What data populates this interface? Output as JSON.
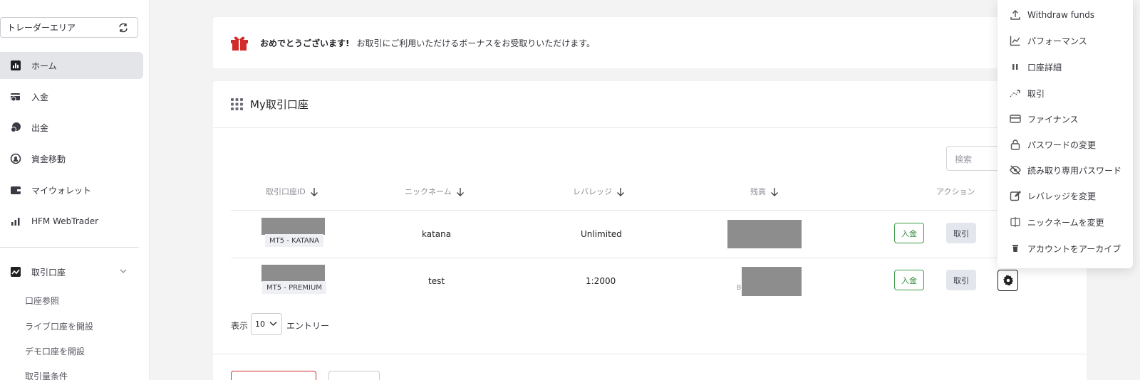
{
  "sidebar": {
    "area_select": "トレーダーエリア",
    "items": [
      {
        "label": "ホーム",
        "icon": "chart-bar-icon"
      },
      {
        "label": "入金",
        "icon": "deposit-icon"
      },
      {
        "label": "出金",
        "icon": "withdraw-icon"
      },
      {
        "label": "資金移動",
        "icon": "transfer-icon"
      },
      {
        "label": "マイウォレット",
        "icon": "wallet-icon"
      },
      {
        "label": "HFM WebTrader",
        "icon": "bar-chart-icon"
      }
    ],
    "section": {
      "label": "取引口座",
      "icon": "trading-icon"
    },
    "sub_items": [
      "口座参照",
      "ライブ口座を開設",
      "デモ口座を開設",
      "取引量条件"
    ]
  },
  "banner": {
    "bold": "おめでとうございます!",
    "message": "お取引にご利用いただけるボーナスをお受取りいただけます。"
  },
  "accounts": {
    "title": "My取引口座",
    "search_placeholder": "検索",
    "columns": [
      "取引口座ID",
      "ニックネーム",
      "レバレッジ",
      "残高",
      "アクション"
    ],
    "rows": [
      {
        "type": "MT5 - KATANA",
        "nickname": "katana",
        "leverage": "Unlimited",
        "balance_hint": "",
        "deposit": "入金",
        "trade": "取引"
      },
      {
        "type": "MT5 - PREMIUM",
        "nickname": "test",
        "leverage": "1:2000",
        "balance_hint": "B(",
        "deposit": "入金",
        "trade": "取引"
      }
    ],
    "show_label": "表示",
    "page_size": "10",
    "entries_label": "エントリー"
  },
  "dropdown": {
    "items": [
      {
        "label": "Withdraw funds",
        "icon": "upload-icon"
      },
      {
        "label": "パフォーマンス",
        "icon": "line-chart-icon"
      },
      {
        "label": "口座詳細",
        "icon": "details-icon"
      },
      {
        "label": "取引",
        "icon": "trade-icon"
      },
      {
        "label": "ファイナンス",
        "icon": "credit-card-icon"
      },
      {
        "label": "パスワードの変更",
        "icon": "lock-icon"
      },
      {
        "label": "読み取り専用パスワード",
        "icon": "eye-off-icon"
      },
      {
        "label": "レバレッジを変更",
        "icon": "edit-icon"
      },
      {
        "label": "ニックネームを変更",
        "icon": "rename-icon"
      },
      {
        "label": "アカウントをアーカイブ",
        "icon": "trash-icon"
      }
    ]
  },
  "colors": {
    "accent_green": "#2f8a3a",
    "accent_red": "#d22b2b",
    "active_bg": "#e3e5e9"
  }
}
